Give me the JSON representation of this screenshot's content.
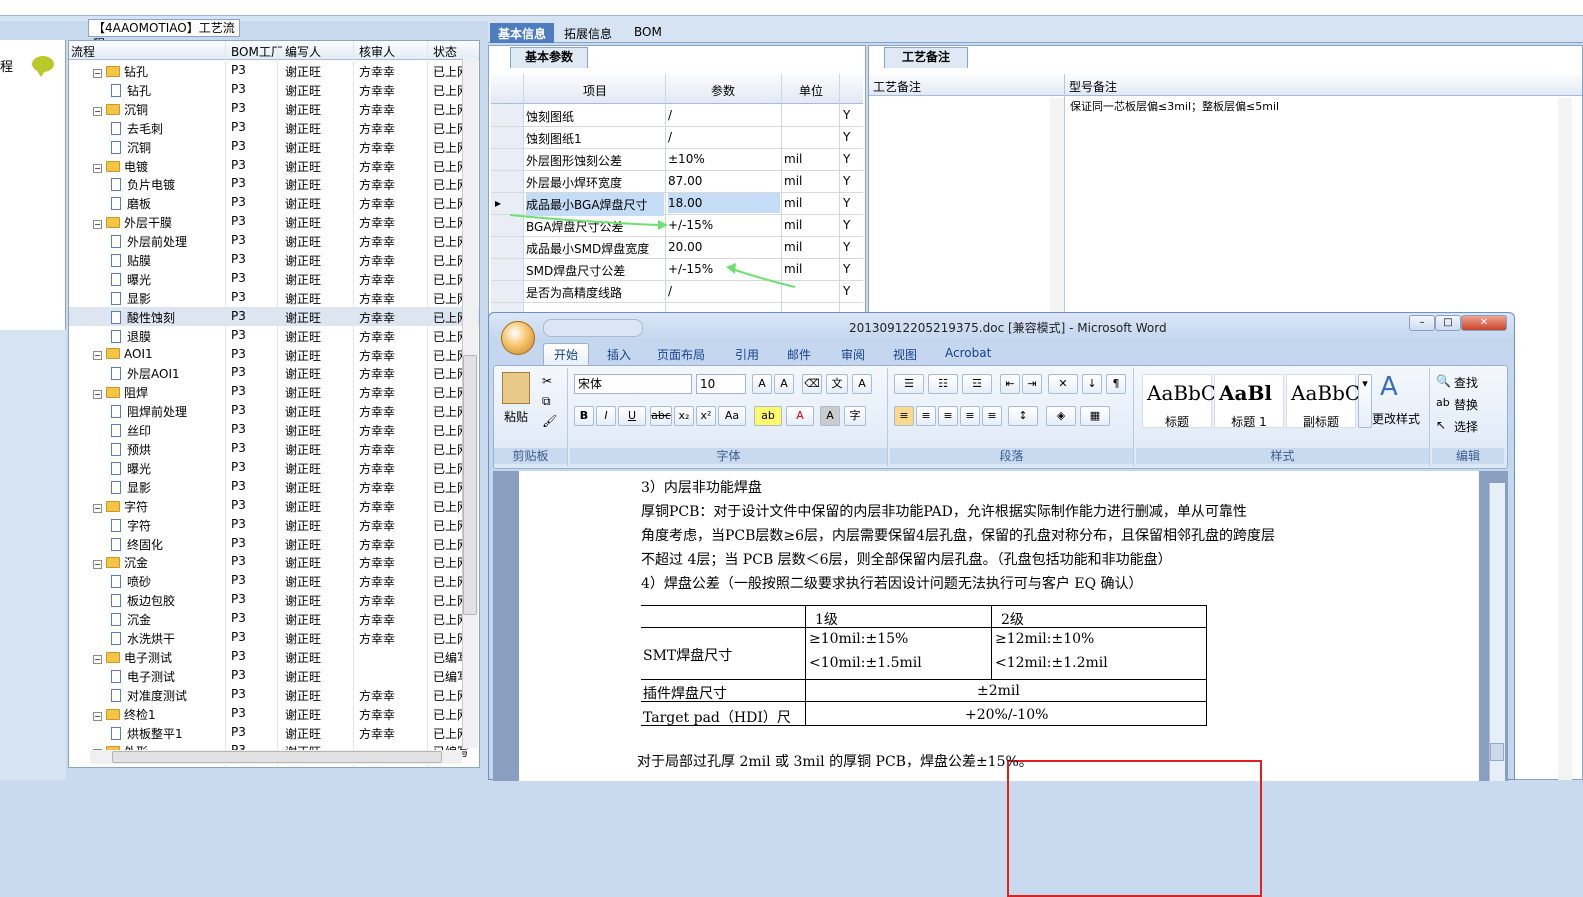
{
  "flow_window": {
    "title": "【4AAOMOTIAO】工艺流程",
    "left_label": "程"
  },
  "tree": {
    "headers": [
      "流程",
      "BOM工厂",
      "编写人",
      "核审人",
      "状态"
    ],
    "rows": [
      {
        "indent": 1,
        "type": "folder",
        "name": "钻孔",
        "bom": "P3",
        "writer": "谢正旺",
        "reviewer": "方幸幸",
        "status": "已上网"
      },
      {
        "indent": 2,
        "type": "doc",
        "name": "钻孔",
        "bom": "P3",
        "writer": "谢正旺",
        "reviewer": "方幸幸",
        "status": "已上网"
      },
      {
        "indent": 1,
        "type": "folder",
        "name": "沉铜",
        "bom": "P3",
        "writer": "谢正旺",
        "reviewer": "方幸幸",
        "status": "已上网"
      },
      {
        "indent": 2,
        "type": "doc",
        "name": "去毛刺",
        "bom": "P3",
        "writer": "谢正旺",
        "reviewer": "方幸幸",
        "status": "已上网"
      },
      {
        "indent": 2,
        "type": "doc",
        "name": "沉铜",
        "bom": "P3",
        "writer": "谢正旺",
        "reviewer": "方幸幸",
        "status": "已上网"
      },
      {
        "indent": 1,
        "type": "folder",
        "name": "电镀",
        "bom": "P3",
        "writer": "谢正旺",
        "reviewer": "方幸幸",
        "status": "已上网"
      },
      {
        "indent": 2,
        "type": "doc",
        "name": "负片电镀",
        "bom": "P3",
        "writer": "谢正旺",
        "reviewer": "方幸幸",
        "status": "已上网"
      },
      {
        "indent": 2,
        "type": "doc",
        "name": "磨板",
        "bom": "P3",
        "writer": "谢正旺",
        "reviewer": "方幸幸",
        "status": "已上网"
      },
      {
        "indent": 1,
        "type": "folder",
        "name": "外层干膜",
        "bom": "P3",
        "writer": "谢正旺",
        "reviewer": "方幸幸",
        "status": "已上网"
      },
      {
        "indent": 2,
        "type": "doc",
        "name": "外层前处理",
        "bom": "P3",
        "writer": "谢正旺",
        "reviewer": "方幸幸",
        "status": "已上网"
      },
      {
        "indent": 2,
        "type": "doc",
        "name": "贴膜",
        "bom": "P3",
        "writer": "谢正旺",
        "reviewer": "方幸幸",
        "status": "已上网"
      },
      {
        "indent": 2,
        "type": "doc",
        "name": "曝光",
        "bom": "P3",
        "writer": "谢正旺",
        "reviewer": "方幸幸",
        "status": "已上网"
      },
      {
        "indent": 2,
        "type": "doc",
        "name": "显影",
        "bom": "P3",
        "writer": "谢正旺",
        "reviewer": "方幸幸",
        "status": "已上网"
      },
      {
        "indent": 2,
        "type": "doc",
        "name": "酸性蚀刻",
        "bom": "P3",
        "writer": "谢正旺",
        "reviewer": "方幸幸",
        "status": "已上网",
        "selected": true
      },
      {
        "indent": 2,
        "type": "doc",
        "name": "退膜",
        "bom": "P3",
        "writer": "谢正旺",
        "reviewer": "方幸幸",
        "status": "已上网"
      },
      {
        "indent": 1,
        "type": "folder",
        "name": "AOI1",
        "bom": "P3",
        "writer": "谢正旺",
        "reviewer": "方幸幸",
        "status": "已上网"
      },
      {
        "indent": 2,
        "type": "doc",
        "name": "外层AOI1",
        "bom": "P3",
        "writer": "谢正旺",
        "reviewer": "方幸幸",
        "status": "已上网"
      },
      {
        "indent": 1,
        "type": "folder",
        "name": "阻焊",
        "bom": "P3",
        "writer": "谢正旺",
        "reviewer": "方幸幸",
        "status": "已上网"
      },
      {
        "indent": 2,
        "type": "doc",
        "name": "阻焊前处理",
        "bom": "P3",
        "writer": "谢正旺",
        "reviewer": "方幸幸",
        "status": "已上网"
      },
      {
        "indent": 2,
        "type": "doc",
        "name": "丝印",
        "bom": "P3",
        "writer": "谢正旺",
        "reviewer": "方幸幸",
        "status": "已上网"
      },
      {
        "indent": 2,
        "type": "doc",
        "name": "预烘",
        "bom": "P3",
        "writer": "谢正旺",
        "reviewer": "方幸幸",
        "status": "已上网"
      },
      {
        "indent": 2,
        "type": "doc",
        "name": "曝光",
        "bom": "P3",
        "writer": "谢正旺",
        "reviewer": "方幸幸",
        "status": "已上网"
      },
      {
        "indent": 2,
        "type": "doc",
        "name": "显影",
        "bom": "P3",
        "writer": "谢正旺",
        "reviewer": "方幸幸",
        "status": "已上网"
      },
      {
        "indent": 1,
        "type": "folder",
        "name": "字符",
        "bom": "P3",
        "writer": "谢正旺",
        "reviewer": "方幸幸",
        "status": "已上网"
      },
      {
        "indent": 2,
        "type": "doc",
        "name": "字符",
        "bom": "P3",
        "writer": "谢正旺",
        "reviewer": "方幸幸",
        "status": "已上网"
      },
      {
        "indent": 2,
        "type": "doc",
        "name": "终固化",
        "bom": "P3",
        "writer": "谢正旺",
        "reviewer": "方幸幸",
        "status": "已上网"
      },
      {
        "indent": 1,
        "type": "folder",
        "name": "沉金",
        "bom": "P3",
        "writer": "谢正旺",
        "reviewer": "方幸幸",
        "status": "已上网"
      },
      {
        "indent": 2,
        "type": "doc",
        "name": "喷砂",
        "bom": "P3",
        "writer": "谢正旺",
        "reviewer": "方幸幸",
        "status": "已上网"
      },
      {
        "indent": 2,
        "type": "doc",
        "name": "板边包胶",
        "bom": "P3",
        "writer": "谢正旺",
        "reviewer": "方幸幸",
        "status": "已上网"
      },
      {
        "indent": 2,
        "type": "doc",
        "name": "沉金",
        "bom": "P3",
        "writer": "谢正旺",
        "reviewer": "方幸幸",
        "status": "已上网"
      },
      {
        "indent": 2,
        "type": "doc",
        "name": "水洗烘干",
        "bom": "P3",
        "writer": "谢正旺",
        "reviewer": "方幸幸",
        "status": "已上网"
      },
      {
        "indent": 1,
        "type": "folder",
        "name": "电子测试",
        "bom": "P3",
        "writer": "谢正旺",
        "reviewer": "",
        "status": "已编写"
      },
      {
        "indent": 2,
        "type": "doc",
        "name": "电子测试",
        "bom": "P3",
        "writer": "谢正旺",
        "reviewer": "",
        "status": "已编写"
      },
      {
        "indent": 2,
        "type": "doc",
        "name": "对准度测试",
        "bom": "P3",
        "writer": "谢正旺",
        "reviewer": "方幸幸",
        "status": "已上网"
      },
      {
        "indent": 1,
        "type": "folder",
        "name": "终检1",
        "bom": "P3",
        "writer": "谢正旺",
        "reviewer": "方幸幸",
        "status": "已上网"
      },
      {
        "indent": 2,
        "type": "doc",
        "name": "烘板整平1",
        "bom": "P3",
        "writer": "谢正旺",
        "reviewer": "方幸幸",
        "status": "已上网"
      },
      {
        "indent": 1,
        "type": "folder",
        "name": "外形",
        "bom": "P3",
        "writer": "谢正旺",
        "reviewer": "",
        "status": "已编写"
      }
    ]
  },
  "tabs": [
    "基本信息",
    "拓展信息",
    "BOM"
  ],
  "base_params": {
    "tab_label": "基本参数",
    "headers": [
      "项目",
      "参数",
      "单位"
    ],
    "rows": [
      {
        "item": "蚀刻图纸",
        "param": "/",
        "unit": "",
        "flag": "Y"
      },
      {
        "item": "蚀刻图纸1",
        "param": "/",
        "unit": "",
        "flag": "Y"
      },
      {
        "item": "外层图形蚀刻公差",
        "param": "±10%",
        "unit": "mil",
        "flag": "Y"
      },
      {
        "item": "外层最小焊环宽度",
        "param": "87.00",
        "unit": "mil",
        "flag": "Y"
      },
      {
        "item": "成品最小BGA焊盘尺寸",
        "param": "18.00",
        "unit": "mil",
        "flag": "Y",
        "selected": true
      },
      {
        "item": "BGA焊盘尺寸公差",
        "param": "+/-15%",
        "unit": "mil",
        "flag": "Y"
      },
      {
        "item": "成品最小SMD焊盘宽度",
        "param": "20.00",
        "unit": "mil",
        "flag": "Y"
      },
      {
        "item": "SMD焊盘尺寸公差",
        "param": "+/-15%",
        "unit": "mil",
        "flag": "Y"
      },
      {
        "item": "是否为高精度线路",
        "param": "/",
        "unit": "",
        "flag": "Y"
      }
    ]
  },
  "process_note": {
    "tab_label": "工艺备注",
    "col1": "工艺备注",
    "col2": "型号备注",
    "model_note": "保证同一芯板层偏≤3mil；整板层偏≤5mil"
  },
  "word": {
    "title": "20130912205219375.doc [兼容模式] - Microsoft Word",
    "menus": [
      "开始",
      "插入",
      "页面布局",
      "引用",
      "邮件",
      "审阅",
      "视图",
      "Acrobat"
    ],
    "font_name": "宋体",
    "font_size": "10",
    "groups": {
      "clipboard": "剪贴板",
      "font": "字体",
      "paragraph": "段落",
      "styles": "样式",
      "edit": "编辑"
    },
    "paste_label": "粘贴",
    "styles": [
      {
        "preview": "AaBbC",
        "name": "标题"
      },
      {
        "preview": "AaBl",
        "name": "标题 1"
      },
      {
        "preview": "AaBbC",
        "name": "副标题"
      }
    ],
    "change_styles": "更改样式",
    "edit_items": [
      "查找",
      "替换",
      "选择"
    ],
    "doc_lines": [
      "3）内层非功能焊盘",
      "厚铜PCB：对于设计文件中保留的内层非功能PAD，允许根据实际制作能力进行删减，单从可靠性",
      "角度考虑，当PCB层数≥6层，内层需要保留4层孔盘，保留的孔盘对称分布，且保留相邻孔盘的跨度层",
      "不超过 4层；当 PCB 层数＜6层，则全部保留内层孔盘。（孔盘包括功能和非功能盘）",
      "4）焊盘公差（一般按照二级要求执行若因设计问题无法执行可与客户 EQ 确认）"
    ],
    "table": {
      "h1": "1级",
      "h2": "2级",
      "r1_label": "SMT焊盘尺寸",
      "r1_c1a": "≥10mil:±15%",
      "r1_c1b": "<10mil:±1.5mil",
      "r1_c2a": "≥12mil:±10%",
      "r1_c2b": "<12mil:±1.2mil",
      "r2_label": "插件焊盘尺寸",
      "r2_val": "±2mil",
      "r3_label": "Target pad（HDI）尺",
      "r3_val": "+20%/-10%"
    },
    "footer_line": "对于局部过孔厚 2mil 或 3mil 的厚铜 PCB，焊盘公差±15%。"
  }
}
